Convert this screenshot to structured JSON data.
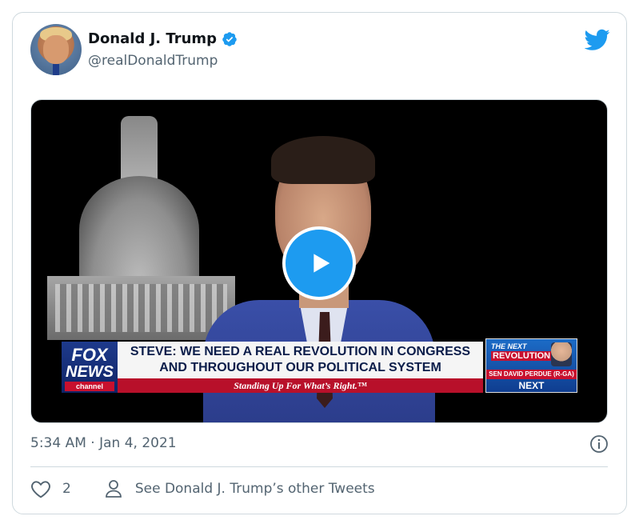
{
  "tweet": {
    "display_name": "Donald J. Trump",
    "handle": "@realDonaldTrump",
    "timestamp": "5:34 AM · Jan 4, 2021",
    "like_count": "2",
    "other_tweets_label": "See Donald J. Trump’s other Tweets"
  },
  "video": {
    "fox_logo": {
      "line1": "FOX",
      "line2": "NEWS",
      "line3": "channel"
    },
    "headline": "STEVE: WE NEED A REAL REVOLUTION IN CONGRESS AND THROUGHOUT OUR POLITICAL SYSTEM",
    "tagline": "Standing Up For What’s Right.™",
    "next_box": {
      "title": "THE NEXT",
      "show": "REVOLUTION",
      "guest": "SEN DAVID PERDUE (R-GA)",
      "label": "NEXT"
    }
  },
  "icons": {
    "verified": "verified-badge-icon",
    "brand": "twitter-bird-icon",
    "play": "play-icon",
    "info": "info-icon",
    "like": "heart-icon",
    "profile": "person-icon"
  },
  "colors": {
    "accent": "#1d9bf0",
    "text_primary": "#0f1419",
    "text_secondary": "#536471",
    "border": "#cfd9de"
  }
}
